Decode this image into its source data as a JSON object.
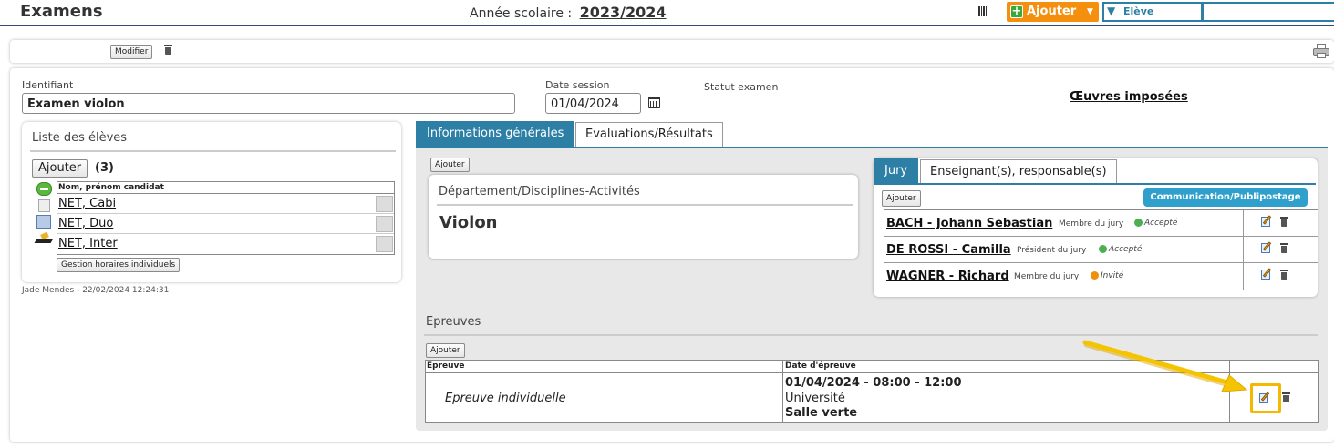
{
  "header": {
    "title": "Examens",
    "year_label": "Année scolaire :",
    "year_value": "2023/2024",
    "add_label": "Ajouter",
    "select_value": "Elève",
    "search_value": ""
  },
  "toolbar": {
    "modify_label": "Modifier"
  },
  "form": {
    "id_label": "Identifiant",
    "id_value": "Examen violon",
    "date_label": "Date session",
    "date_value": "01/04/2024",
    "status_label": "Statut examen",
    "oeuvres_label": "Œuvres imposées"
  },
  "students": {
    "title": "Liste des élèves",
    "add_label": "Ajouter",
    "count": "(3)",
    "column_header": "Nom, prénom candidat",
    "rows": [
      "NET, Cabi",
      "NET, Duo",
      "NET, Inter"
    ],
    "schedule_label": "Gestion horaires individuels"
  },
  "audit": "Jade Mendes - 22/02/2024 12:24:31",
  "tabs": [
    "Informations générales",
    "Evaluations/Résultats"
  ],
  "info": {
    "add_label": "Ajouter",
    "dept_title": "Département/Disciplines-Activités",
    "dept_value": "Violon"
  },
  "jury": {
    "tabs": [
      "Jury",
      "Enseignant(s), responsable(s)"
    ],
    "add_label": "Ajouter",
    "comm_label": "Communication/Publipostage",
    "members": [
      {
        "name": "BACH - Johann Sebastian",
        "role": "Membre du jury",
        "status": "Accepté",
        "color": "#4caf50"
      },
      {
        "name": "DE ROSSI - Camilla",
        "role": "Président du jury",
        "status": "Accepté",
        "color": "#4caf50"
      },
      {
        "name": "WAGNER - Richard",
        "role": "Membre du jury",
        "status": "Invité",
        "color": "#f0900a"
      }
    ]
  },
  "epreuves": {
    "title": "Epreuves",
    "add_label": "Ajouter",
    "col_epreuve": "Epreuve",
    "col_date": "Date d'épreuve",
    "rows": [
      {
        "name": "Epreuve individuelle",
        "datetime": "01/04/2024 - 08:00 - 12:00",
        "place": "Université",
        "room": "Salle verte"
      }
    ]
  },
  "colors": {
    "accent": "#2d7fa6",
    "orange": "#f5900e",
    "highlight": "#f5b800"
  }
}
